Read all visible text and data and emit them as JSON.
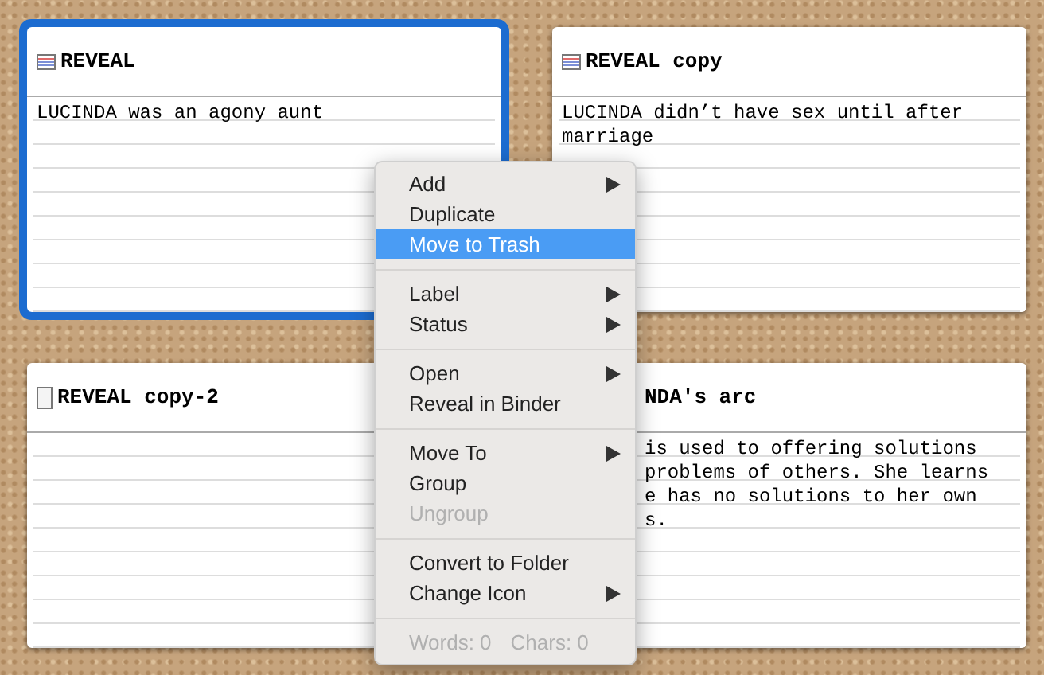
{
  "cards": [
    {
      "title": "REVEAL",
      "kind": "lined",
      "selected": true,
      "lines": [
        "LUCINDA was an agony aunt"
      ]
    },
    {
      "title": "REVEAL copy",
      "kind": "lined",
      "selected": false,
      "lines": [
        "LUCINDA didn’t have sex until after",
        "marriage"
      ]
    },
    {
      "title": "REVEAL copy-2",
      "kind": "blank",
      "selected": false
    },
    {
      "title": "NDA's arc",
      "kind": "hidden",
      "selected": false,
      "lines": [
        "is used to offering solutions",
        "problems of others. She learns",
        "e has no solutions to her own",
        "s."
      ]
    }
  ],
  "context_menu": {
    "groups": [
      [
        {
          "label": "Add",
          "submenu": true,
          "selected": false,
          "disabled": false
        },
        {
          "label": "Duplicate",
          "submenu": false,
          "selected": false,
          "disabled": false
        },
        {
          "label": "Move to Trash",
          "submenu": false,
          "selected": true,
          "disabled": false
        }
      ],
      [
        {
          "label": "Label",
          "submenu": true,
          "selected": false,
          "disabled": false
        },
        {
          "label": "Status",
          "submenu": true,
          "selected": false,
          "disabled": false
        }
      ],
      [
        {
          "label": "Open",
          "submenu": true,
          "selected": false,
          "disabled": false
        },
        {
          "label": "Reveal in Binder",
          "submenu": false,
          "selected": false,
          "disabled": false
        }
      ],
      [
        {
          "label": "Move To",
          "submenu": true,
          "selected": false,
          "disabled": false
        },
        {
          "label": "Group",
          "submenu": false,
          "selected": false,
          "disabled": false
        },
        {
          "label": "Ungroup",
          "submenu": false,
          "selected": false,
          "disabled": true
        }
      ],
      [
        {
          "label": "Convert to Folder",
          "submenu": false,
          "selected": false,
          "disabled": false
        },
        {
          "label": "Change Icon",
          "submenu": true,
          "selected": false,
          "disabled": false
        }
      ]
    ],
    "footer": {
      "words": "Words: 0",
      "chars": "Chars: 0"
    }
  }
}
